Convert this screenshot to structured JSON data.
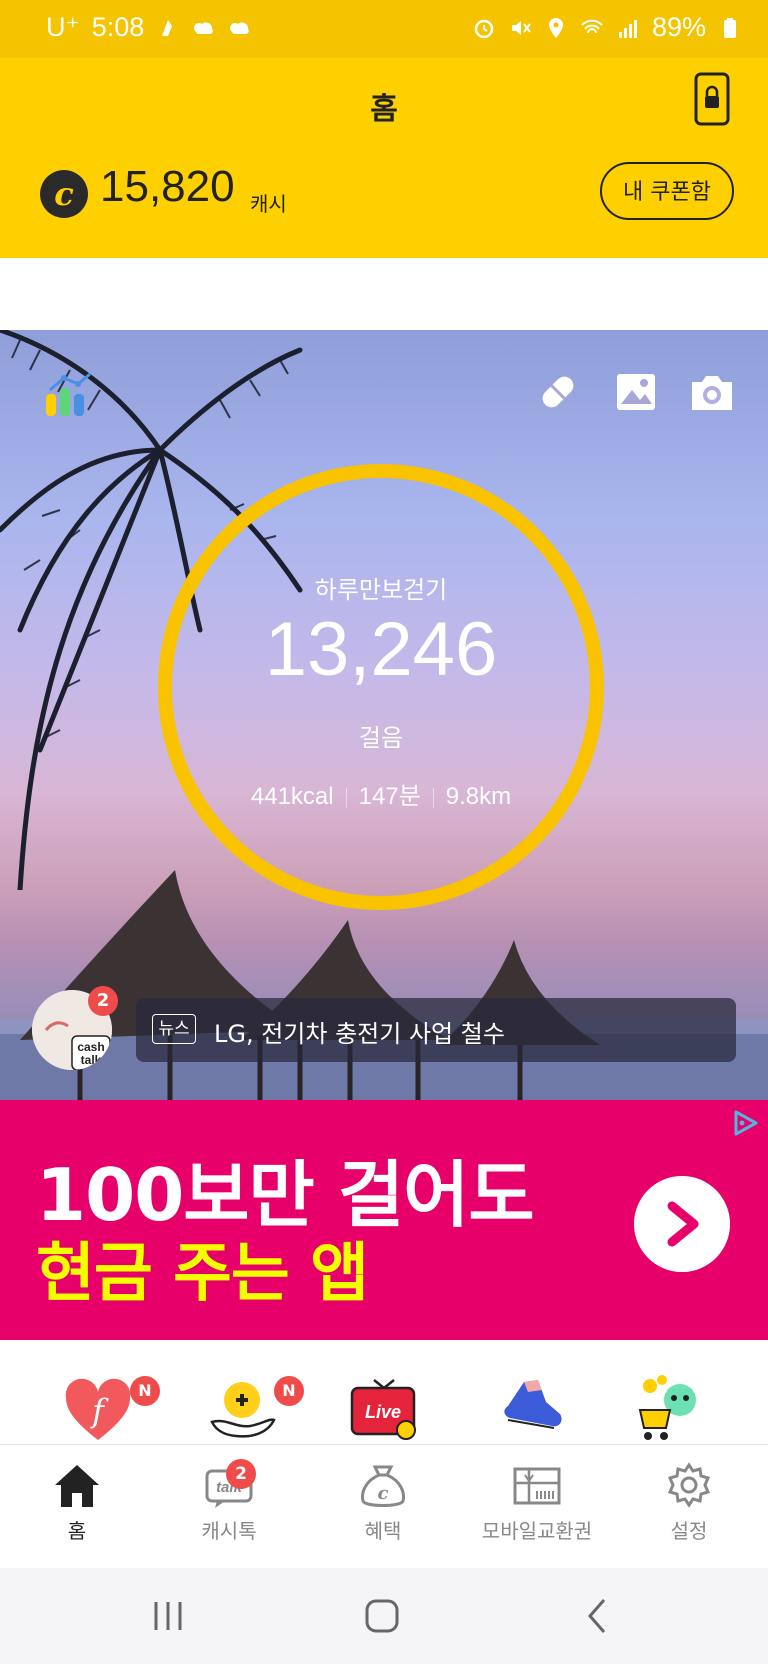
{
  "status_bar": {
    "carrier": "U⁺",
    "time": "5:08",
    "battery": "89%"
  },
  "header": {
    "title": "홈"
  },
  "cash": {
    "icon_letter": "c",
    "amount": "15,820",
    "unit": "캐시",
    "coupon_label": "내 쿠폰함"
  },
  "pedometer": {
    "label": "하루만보걷기",
    "steps": "13,246",
    "unit": "걸음",
    "kcal": "441kcal",
    "minutes": "147분",
    "distance": "9.8km",
    "ring_color": "#f9c300"
  },
  "cashtalk": {
    "badge": "2",
    "logo_line1": "cash",
    "logo_line2": "talk"
  },
  "news": {
    "tag": "뉴스",
    "headline": "LG, 전기차 충전기 사업 철수"
  },
  "ad": {
    "line1": "100보만 걸어도",
    "line2": "현금 주는 앱",
    "bg_color": "#e8006a",
    "highlight_color": "#f3ff00"
  },
  "shortcuts": [
    {
      "icon": "heart-f-icon",
      "badge": "N"
    },
    {
      "icon": "hand-plus-icon",
      "badge": "N"
    },
    {
      "icon": "live-tv-icon",
      "label": "Live"
    },
    {
      "icon": "sneaker-icon"
    },
    {
      "icon": "character-cart-icon"
    }
  ],
  "bottom_nav": {
    "items": [
      {
        "label": "홈",
        "icon": "home-icon",
        "active": true
      },
      {
        "label": "캐시톡",
        "icon": "talk-icon",
        "badge": "2"
      },
      {
        "label": "혜택",
        "icon": "cash-bag-icon"
      },
      {
        "label": "모바일교환권",
        "icon": "voucher-icon"
      },
      {
        "label": "설정",
        "icon": "gear-icon"
      }
    ]
  },
  "colors": {
    "primary_yellow": "#ffd000",
    "badge_red": "#f04b4b"
  }
}
